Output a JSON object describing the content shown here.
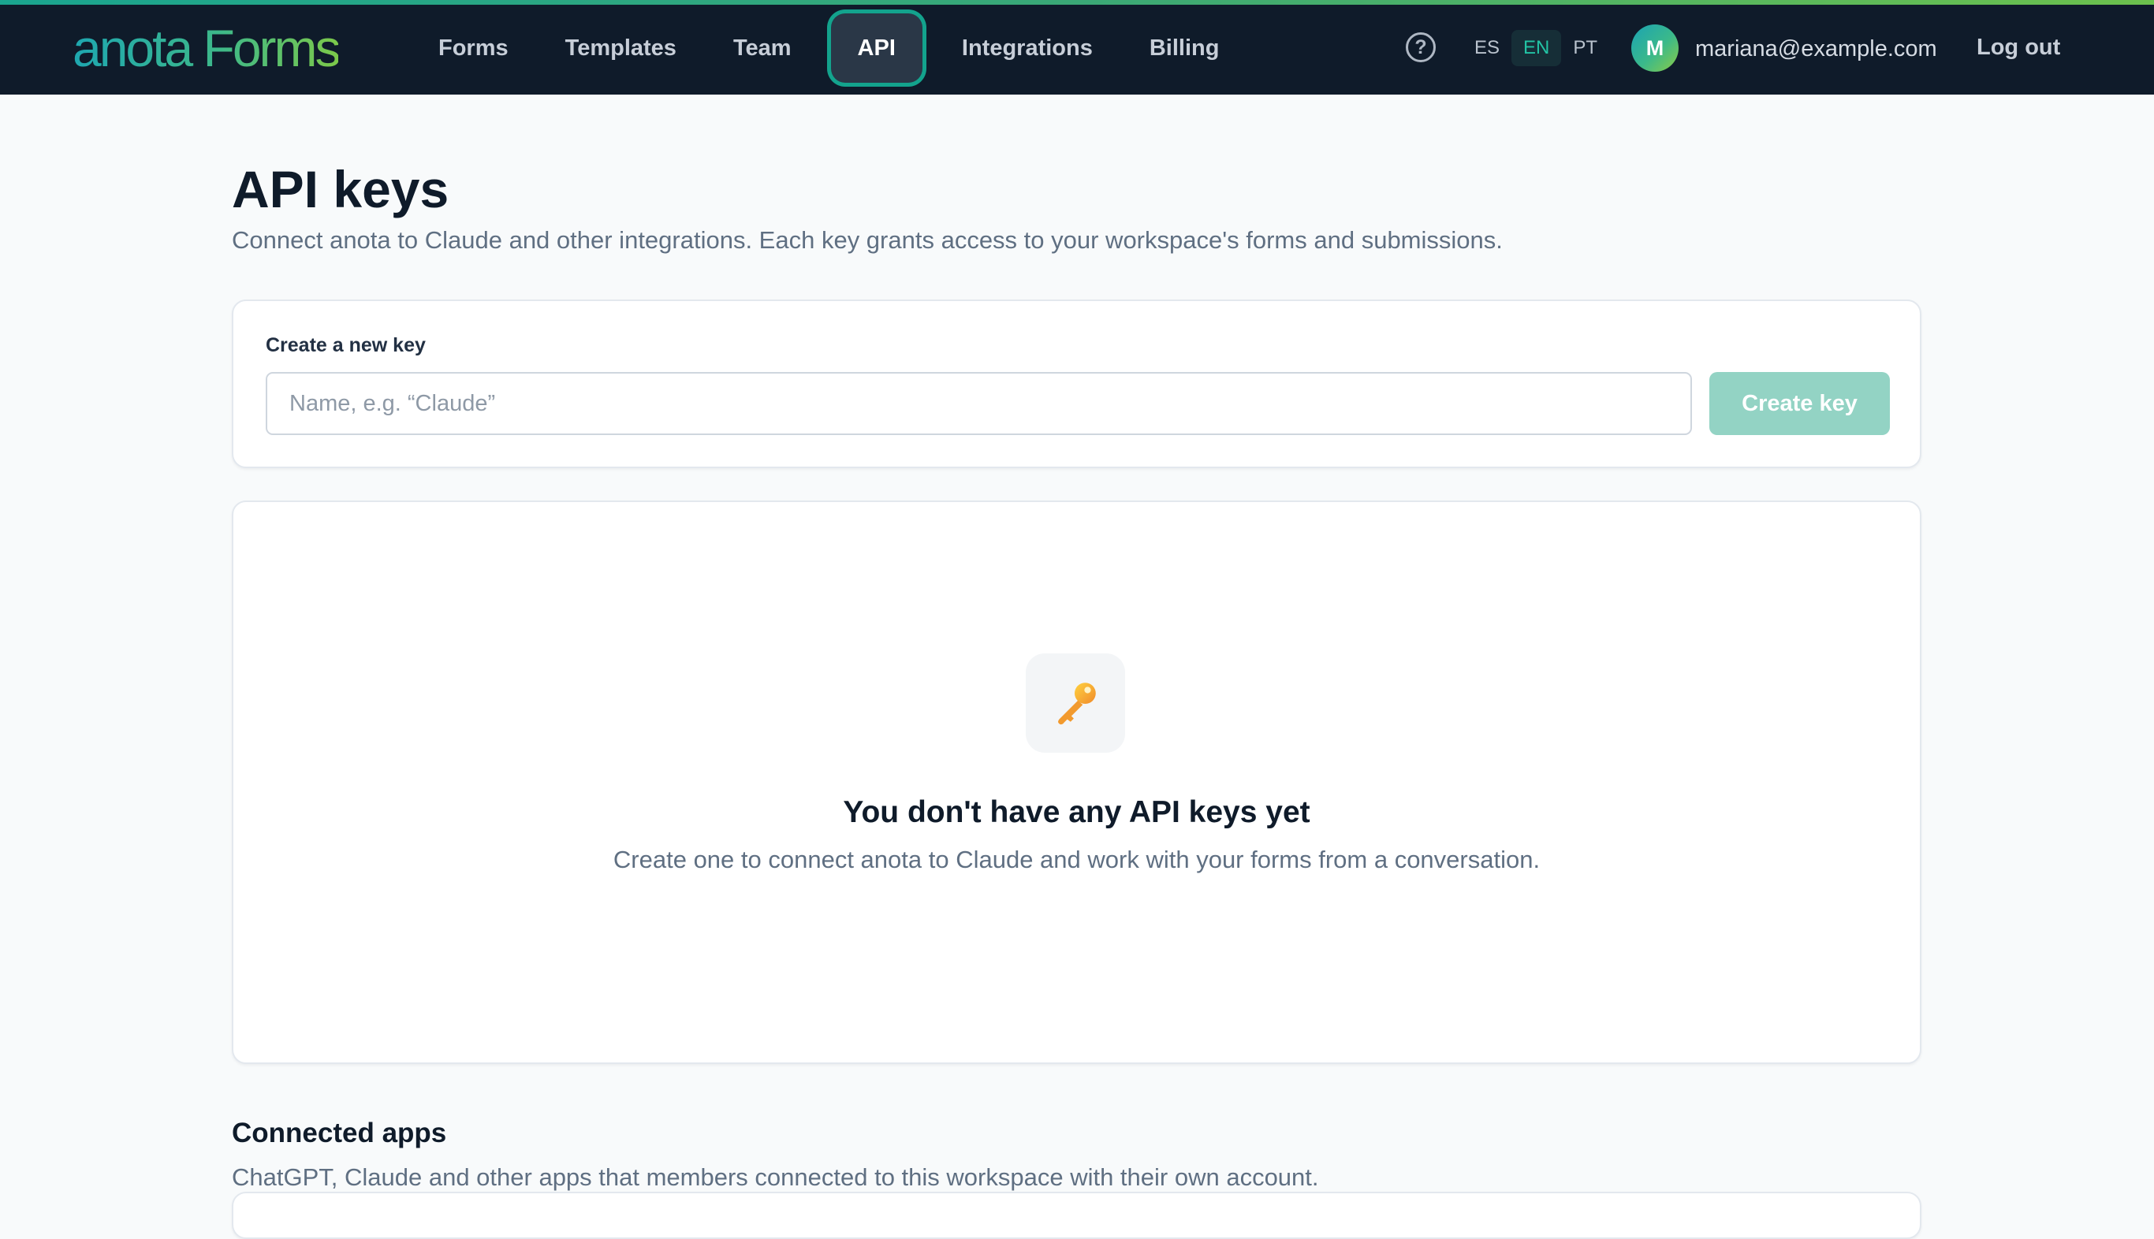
{
  "brand": {
    "logo": "anota Forms"
  },
  "nav": {
    "items": [
      {
        "label": "Forms"
      },
      {
        "label": "Templates"
      },
      {
        "label": "Team"
      },
      {
        "label": "API",
        "active": true
      },
      {
        "label": "Integrations"
      },
      {
        "label": "Billing"
      }
    ]
  },
  "header": {
    "help_glyph": "?",
    "languages": [
      {
        "code": "ES"
      },
      {
        "code": "EN",
        "active": true
      },
      {
        "code": "PT"
      }
    ],
    "user": {
      "initial": "M",
      "email": "mariana@example.com"
    },
    "logout_label": "Log out"
  },
  "page": {
    "title": "API keys",
    "subtitle": "Connect anota to Claude and other integrations. Each key grants access to your workspace's forms and submissions."
  },
  "create_key": {
    "label": "Create a new key",
    "input_value": "",
    "placeholder": "Name, e.g. “Claude”",
    "button_label": "Create key"
  },
  "empty_state": {
    "icon": "key-icon",
    "title": "You don't have any API keys yet",
    "subtitle": "Create one to connect anota to Claude and work with your forms from a conversation."
  },
  "connected_apps": {
    "title": "Connected apps",
    "subtitle": "ChatGPT, Claude and other apps that members connected to this workspace with their own account."
  },
  "colors": {
    "topbar": "#0f1b2a",
    "accent": "#13a38d",
    "button_disabled": "#93d3c4",
    "page_bg": "#f8fafb"
  }
}
